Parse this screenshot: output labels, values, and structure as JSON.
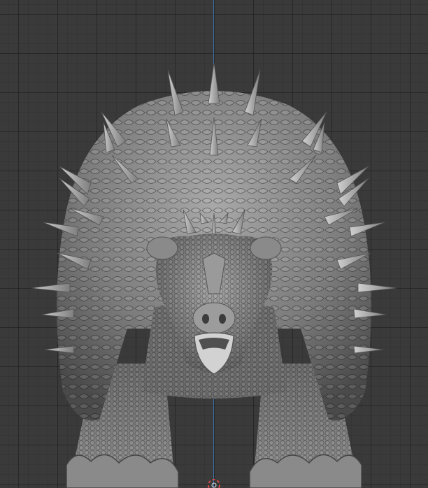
{
  "viewport": {
    "title": "",
    "colors": {
      "background": "#3a3a3a",
      "grid": "#1c1c1c",
      "z_axis": "#3f6fa8",
      "model": "#8c8c8c",
      "cursor": "#d04a4a"
    },
    "icons": {
      "cursor": "3d-cursor-icon"
    }
  }
}
